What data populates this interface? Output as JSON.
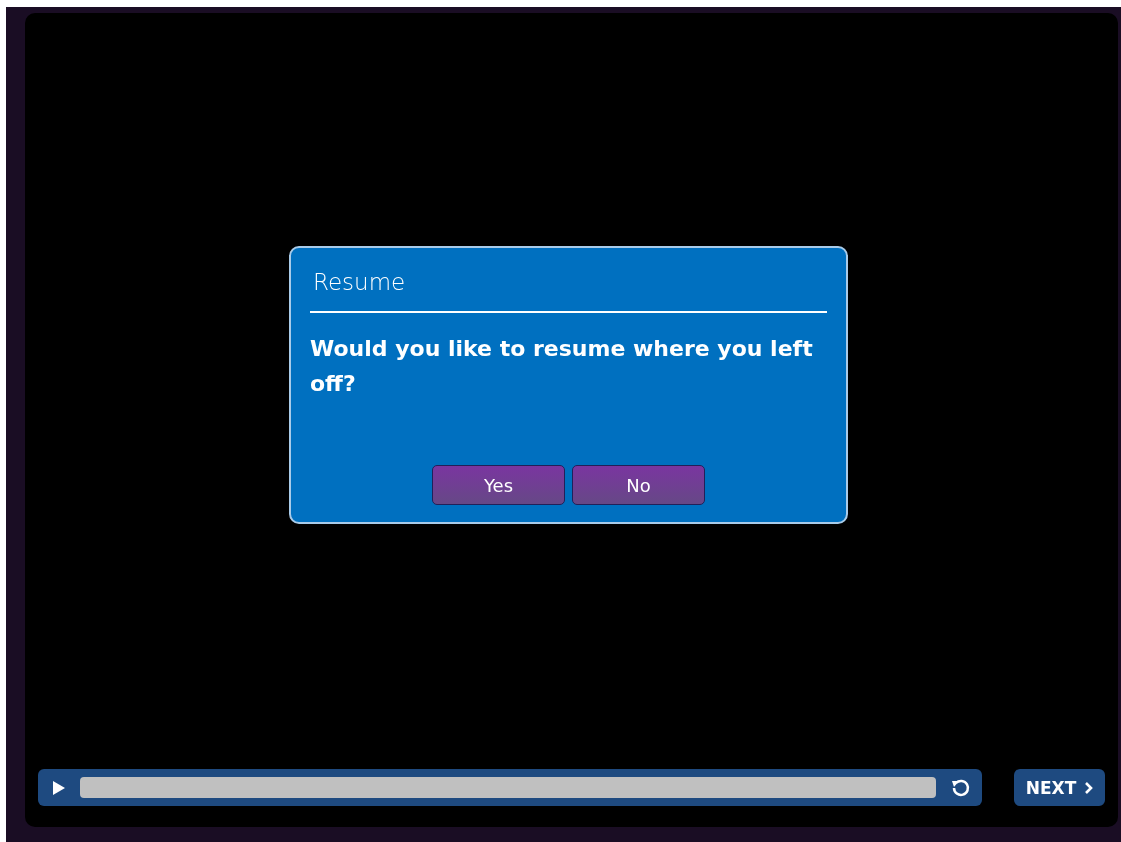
{
  "dialog": {
    "title": "Resume",
    "message": "Would you like to resume where you left off?",
    "buttons": [
      "Yes",
      "No"
    ]
  },
  "player": {
    "next_button": "NEXT"
  }
}
